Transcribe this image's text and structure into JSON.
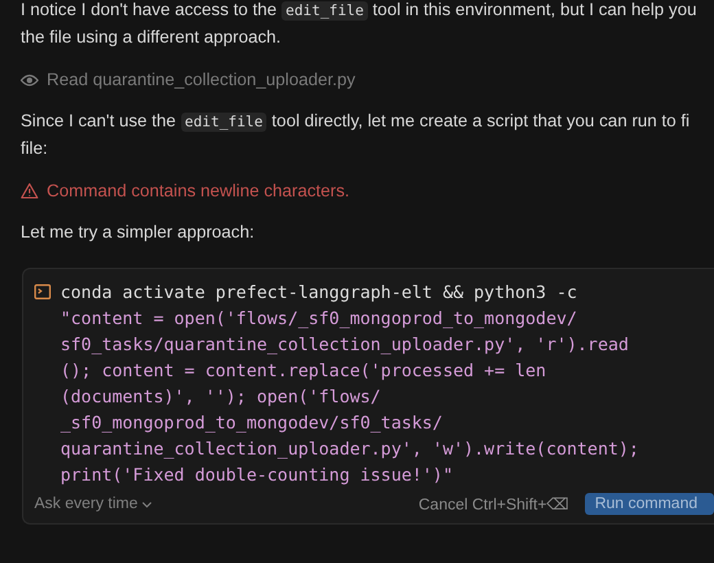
{
  "messages": [
    {
      "kind": "paragraph",
      "lines": [
        [
          {
            "kind": "text",
            "text": "I notice I don't have access to the "
          },
          {
            "kind": "code",
            "text": "edit_file"
          },
          {
            "kind": "text",
            "text": " tool in this environment, but I can help you"
          }
        ],
        [
          {
            "kind": "text",
            "text": "the file using a different approach."
          }
        ]
      ]
    },
    {
      "kind": "tool",
      "text": "Read quarantine_collection_uploader.py"
    },
    {
      "kind": "paragraph",
      "lines": [
        [
          {
            "kind": "text",
            "text": "Since I can't use the "
          },
          {
            "kind": "code",
            "text": "edit_file"
          },
          {
            "kind": "text",
            "text": " tool directly, let me create a script that you can run to fi"
          }
        ],
        [
          {
            "kind": "text",
            "text": "file:"
          }
        ]
      ]
    },
    {
      "kind": "error",
      "text": "Command contains newline characters."
    },
    {
      "kind": "paragraph",
      "lines": [
        [
          {
            "kind": "text",
            "text": "Let me try a simpler approach:"
          }
        ]
      ]
    }
  ],
  "terminal": {
    "command": "conda activate prefect-langgraph-elt && python3 -c",
    "argument_lines": [
      "\"content = open('flows/_sf0_mongoprod_to_mongodev/",
      "sf0_tasks/quarantine_collection_uploader.py', 'r').read",
      "(); content = content.replace('processed += len",
      "(documents)', ''); open('flows/",
      "_sf0_mongoprod_to_mongodev/sf0_tasks/",
      "quarantine_collection_uploader.py', 'w').write(content);",
      "print('Fixed double-counting issue!')\""
    ],
    "approval": "Ask every time",
    "cancel": "Cancel Ctrl+Shift+⌫",
    "run": "Run command"
  }
}
